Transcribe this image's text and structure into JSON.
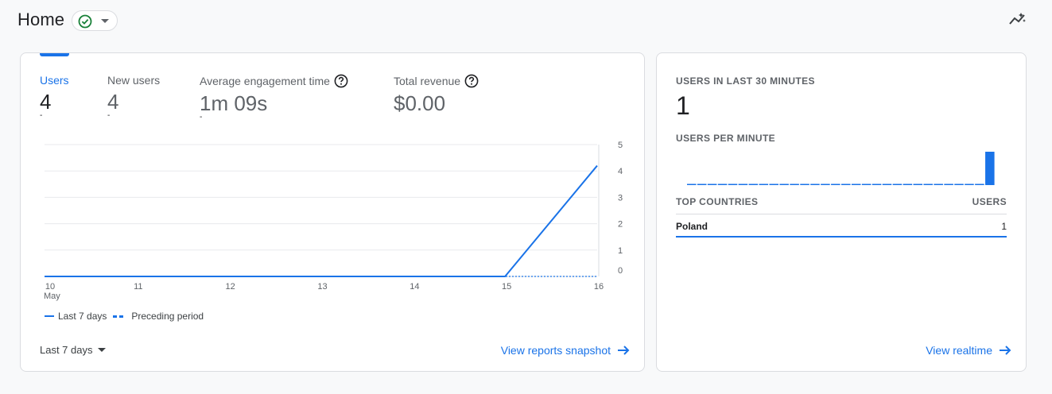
{
  "header": {
    "title": "Home",
    "status": "check-circle-icon"
  },
  "colors": {
    "accent": "#1a73e8",
    "status_green": "#188038"
  },
  "overview": {
    "metrics": [
      {
        "label": "Users",
        "value": "4",
        "help": false,
        "selected": true
      },
      {
        "label": "New users",
        "value": "4",
        "help": false,
        "selected": false
      },
      {
        "label": "Average engagement time",
        "value": "1m 09s",
        "help": true,
        "selected": false
      },
      {
        "label": "Total revenue",
        "value": "$0.00",
        "help": true,
        "selected": false
      }
    ],
    "legend": {
      "current": "Last 7 days",
      "previous": "Preceding period"
    },
    "date_range": "Last 7 days",
    "snapshot_link": "View reports snapshot"
  },
  "chart_data": {
    "type": "line",
    "x": [
      "10",
      "11",
      "12",
      "13",
      "14",
      "15",
      "16"
    ],
    "x_sublabel": "May",
    "series": [
      {
        "name": "Last 7 days",
        "values": [
          0,
          0,
          0,
          0,
          0,
          0,
          4.2
        ],
        "style": "solid"
      },
      {
        "name": "Preceding period",
        "values": [
          0,
          0,
          0,
          0,
          0,
          0,
          0
        ],
        "style": "dashed"
      }
    ],
    "yticks": [
      "5",
      "4",
      "3",
      "2",
      "1",
      "0"
    ],
    "ylim": [
      0,
      5
    ],
    "axis_side": "right",
    "grid": true,
    "title": "",
    "xlabel": "",
    "ylabel": ""
  },
  "realtime": {
    "title": "USERS IN LAST 30 MINUTES",
    "value": "1",
    "per_minute_label": "USERS PER MINUTE",
    "per_minute": [
      0,
      0,
      0,
      0,
      0,
      0,
      0,
      0,
      0,
      0,
      0,
      0,
      0,
      0,
      0,
      0,
      0,
      0,
      0,
      0,
      0,
      0,
      0,
      0,
      0,
      0,
      0,
      0,
      0,
      1
    ],
    "countries_header": "TOP COUNTRIES",
    "users_header": "USERS",
    "countries": [
      {
        "name": "Poland",
        "users": "1"
      }
    ],
    "realtime_link": "View realtime"
  }
}
